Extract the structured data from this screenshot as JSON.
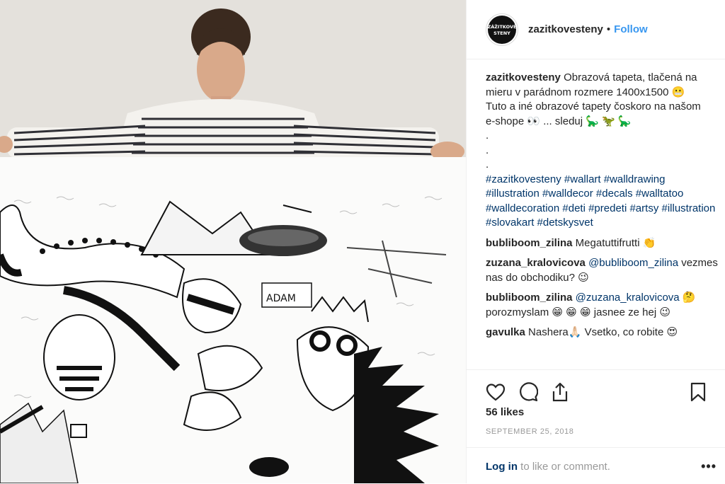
{
  "account": {
    "username": "zazitkovesteny",
    "avatar_text": "ZÁŽITKOVÉ STENY",
    "follow_label": "Follow",
    "separator": "•"
  },
  "caption": {
    "username": "zazitkovesteny",
    "line1": "Obrazová tapeta, tlačená na mieru v parádnom rozmere 1400x1500 😬",
    "line2": "Tuto a iné obrazové tapety čoskoro na našom",
    "line3": "e-shope 👀 ... sleduj 🦕 🦖 🦕",
    "dot1": ".",
    "dot2": ".",
    "dot3": ".",
    "hashtags": "#zazitkovesteny #wallart #walldrawing #illustration #walldecor #decals #walltatoo #walldecoration #deti #predeti #artsy #illustration #slovakart #detskysvet"
  },
  "comments": [
    {
      "user": "bubliboom_zilina",
      "mention": "",
      "text": "Megatuttifrutti 👏"
    },
    {
      "user": "zuzana_kralovicova",
      "mention": "@bubliboom_zilina",
      "text": "vezmes nas do obchodiku? 😉"
    },
    {
      "user": "bubliboom_zilina",
      "mention": "@zuzana_kralovicova",
      "text": "🤔 porozmyslam 😁 😁 😁  jasnee ze hej 😉"
    },
    {
      "user": "gavulka",
      "mention": "",
      "text": "Nashera🙏🏻  Vsetko, co robite 😍"
    }
  ],
  "stats": {
    "likes": "56 likes",
    "date": "SEPTEMBER 25, 2018"
  },
  "footer": {
    "login_link": "Log in",
    "login_rest": " to like or comment.",
    "more": "•••"
  },
  "icons": [
    "heart-icon",
    "comment-icon",
    "share-icon",
    "bookmark-icon"
  ],
  "colors": {
    "link": "#3897f0",
    "hashtag": "#003569",
    "muted": "#999999"
  }
}
